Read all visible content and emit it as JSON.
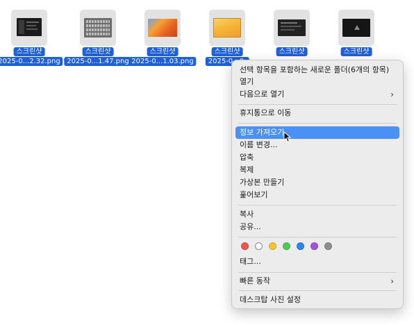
{
  "files": [
    {
      "name1": "스크린샷",
      "name2": "2025-0...2.32.png",
      "thumb": "dark-editor"
    },
    {
      "name1": "스크린샷",
      "name2": "2025-0...1.47.png",
      "thumb": "keyboard"
    },
    {
      "name1": "스크린샷",
      "name2": "2025-0...1.03.png",
      "thumb": "orange-wallpaper"
    },
    {
      "name1": "스크린샷",
      "name2": "2025-0...0.",
      "thumb": "yellow-wallpaper"
    },
    {
      "name1": "스크린샷",
      "name2": "",
      "thumb": "dark-window"
    },
    {
      "name1": "스크린샷",
      "name2": "",
      "thumb": "dark-logo"
    }
  ],
  "menu": {
    "new_folder": "선택 항목을 포함하는 새로운 폴더(6개의 항목)",
    "open": "열기",
    "open_with": "다음으로 열기",
    "trash": "휴지통으로 이동",
    "get_info": "정보 가져오기",
    "rename": "이름 변경...",
    "compress": "압축",
    "duplicate": "복제",
    "alias": "가상본 만들기",
    "quick_look": "훑어보기",
    "copy": "복사",
    "share": "공유...",
    "tags_label": "태그...",
    "quick_actions": "빠른 동작",
    "desktop_picture": "데스크탑 사진 설정"
  },
  "tag_colors": [
    "#f5534a",
    "#ffffff",
    "#f7c234",
    "#4ccb52",
    "#2f84f3",
    "#a454d6",
    "#8e8e8e"
  ]
}
